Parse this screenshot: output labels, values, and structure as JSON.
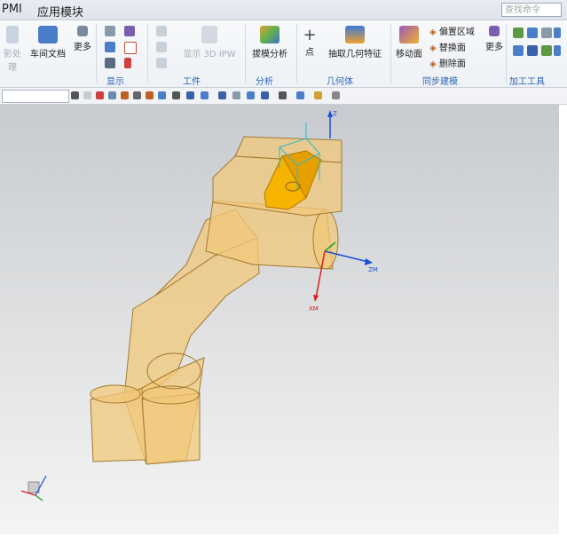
{
  "menubar": {
    "items": [
      "PMI",
      "应用模块"
    ],
    "search_placeholder": "查找命令"
  },
  "ribbon": {
    "buttons": {
      "clip": "影处理",
      "shop_doc": "车间文档",
      "more1": "更多",
      "show_3d": "显示 3D IPW",
      "draft": "拔模分析",
      "point": "点",
      "extract": "抽取几何特征",
      "move_face": "移动面",
      "offset_region": "偏置区域",
      "replace_face": "替换面",
      "delete_face": "删除面",
      "more2": "更多"
    },
    "groups": {
      "display": "显示",
      "workpiece": "工件",
      "analysis": "分析",
      "geometry": "几何体",
      "sync": "同步建模",
      "tools": "加工工具"
    }
  },
  "viewport": {
    "axis_labels": {
      "z": "Z",
      "zm": "ZM",
      "xm": "XM"
    },
    "colors": {
      "part_fill": "#f2c879",
      "part_stroke": "#a07a32",
      "highlight": "#f6b300",
      "axis_blue": "#1a4fd8",
      "axis_green": "#17a02a",
      "axis_red": "#d82020"
    }
  }
}
